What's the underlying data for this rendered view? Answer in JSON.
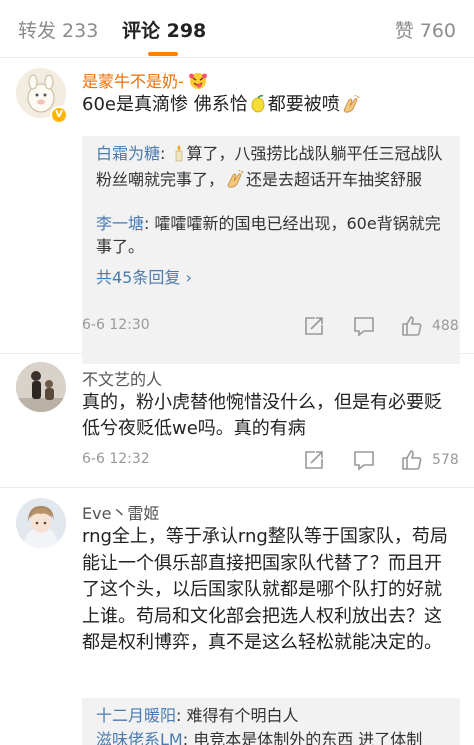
{
  "tabs": {
    "repost": "转发 233",
    "comment": "评论 298",
    "like": "赞 760"
  },
  "comments": [
    {
      "username": "是蒙牛不是奶-",
      "text_a": "60e是真滴惨 佛系恰",
      "text_b": "都要被喷",
      "replies": [
        {
          "name": "白霜为糖",
          "sep": ": ",
          "text_a": "算了，八强捞比战队躺平任三冠战队粉丝嘲就完事了，",
          "text_b": "还是去超话开车抽奖舒服"
        },
        {
          "name": "李一塘",
          "sep": ": ",
          "text": "嚯嚯嚯新的国电已经出现，60e背锅就完事了。"
        }
      ],
      "more_replies": "共45条回复 ›",
      "time": "6-6 12:30",
      "likes": "488"
    },
    {
      "username": "不文艺的人",
      "text": "真的，粉小虎替他惋惜没什么，但是有必要贬低兮夜贬低we吗。真的有病",
      "time": "6-6 12:32",
      "likes": "578"
    },
    {
      "username": "Eve丶雷姬",
      "text": "rng全上，等于承认rng整队等于国家队，苟局能让一个俱乐部直接把国家队代替了？而且开了这个头，以后国家队就都是哪个队打的好就上谁。苟局和文化部会把选人权利放出去？这都是权利博弈，真不是这么轻松就能决定的。",
      "replies": [
        {
          "name": "十二月暖阳",
          "sep": ": ",
          "text": "难得有个明白人"
        },
        {
          "name": "滋味佬系LM",
          "sep": ": ",
          "text": "电竞本是体制外的东西 进了体制"
        }
      ]
    }
  ],
  "icons": [
    "verified-badge-icon",
    "tongue-emoji-icon",
    "lemon-emoji-icon",
    "clap-emoji-icon",
    "candle-emoji-icon",
    "repost-icon",
    "comment-icon",
    "like-icon"
  ],
  "colors": {
    "accent": "#ff8200",
    "link": "#4a7bb0",
    "vip_name": "#f26f00"
  }
}
